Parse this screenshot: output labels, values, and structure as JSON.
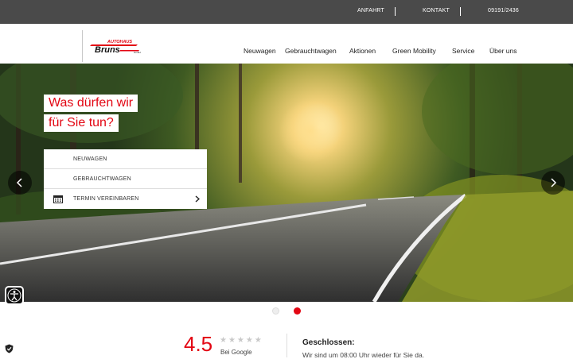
{
  "topbar": {
    "anfahrt": "ANFAHRT",
    "kontakt": "KONTAKT",
    "phone": "09191/2436"
  },
  "logo": {
    "top": "AUTOHAUS",
    "main": "Bruns",
    "suffix": "GmbH"
  },
  "nav": [
    "Neuwagen",
    "Gebrauchtwagen",
    "Aktionen",
    "Green Mobility",
    "Service",
    "Über uns"
  ],
  "hero": {
    "headline_line1": "Was dürfen wir",
    "headline_line2": "für Sie tun?",
    "menu": [
      "NEUWAGEN",
      "GEBRAUCHTWAGEN",
      "TERMIN VEREINBAREN"
    ],
    "slides_total": 2,
    "active_slide": 2
  },
  "rating": {
    "value": "4.5",
    "stars": "★★★★★",
    "source": "Bei Google"
  },
  "hours": {
    "title": "Geschlossen:",
    "text": "Wir sind um 08:00 Uhr wieder für Sie da."
  },
  "colors": {
    "accent": "#e30613",
    "topbar": "#4a4a4a"
  }
}
